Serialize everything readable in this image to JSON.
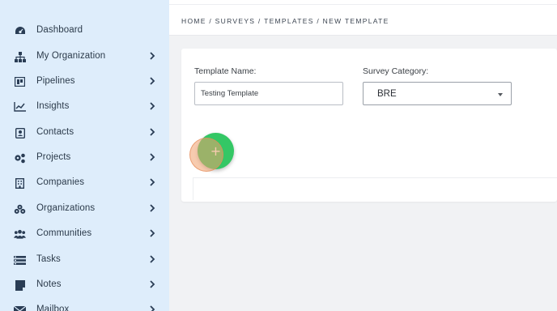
{
  "sidebar": {
    "items": [
      {
        "label": "Dashboard",
        "icon": "dashboard-icon",
        "has_submenu": false
      },
      {
        "label": "My Organization",
        "icon": "org-chart-icon",
        "has_submenu": true
      },
      {
        "label": "Pipelines",
        "icon": "pipelines-icon",
        "has_submenu": true
      },
      {
        "label": "Insights",
        "icon": "insights-icon",
        "has_submenu": true
      },
      {
        "label": "Contacts",
        "icon": "contacts-icon",
        "has_submenu": true
      },
      {
        "label": "Projects",
        "icon": "projects-icon",
        "has_submenu": true
      },
      {
        "label": "Companies",
        "icon": "companies-icon",
        "has_submenu": true
      },
      {
        "label": "Organizations",
        "icon": "organizations-icon",
        "has_submenu": true
      },
      {
        "label": "Communities",
        "icon": "communities-icon",
        "has_submenu": true
      },
      {
        "label": "Tasks",
        "icon": "tasks-icon",
        "has_submenu": true
      },
      {
        "label": "Notes",
        "icon": "notes-icon",
        "has_submenu": true
      },
      {
        "label": "Mailbox",
        "icon": "mailbox-icon",
        "has_submenu": true
      }
    ]
  },
  "breadcrumb": "HOME / SURVEYS / TEMPLATES / NEW TEMPLATE",
  "form": {
    "template_name_label": "Template Name:",
    "template_name_value": "Testing Template",
    "survey_category_label": "Survey Category:",
    "survey_category_value": "BRE",
    "add_button_label": "+"
  },
  "colors": {
    "sidebar_bg": "#deedfb",
    "add_button": "#34c765",
    "click_highlight": "#f0a06e"
  }
}
